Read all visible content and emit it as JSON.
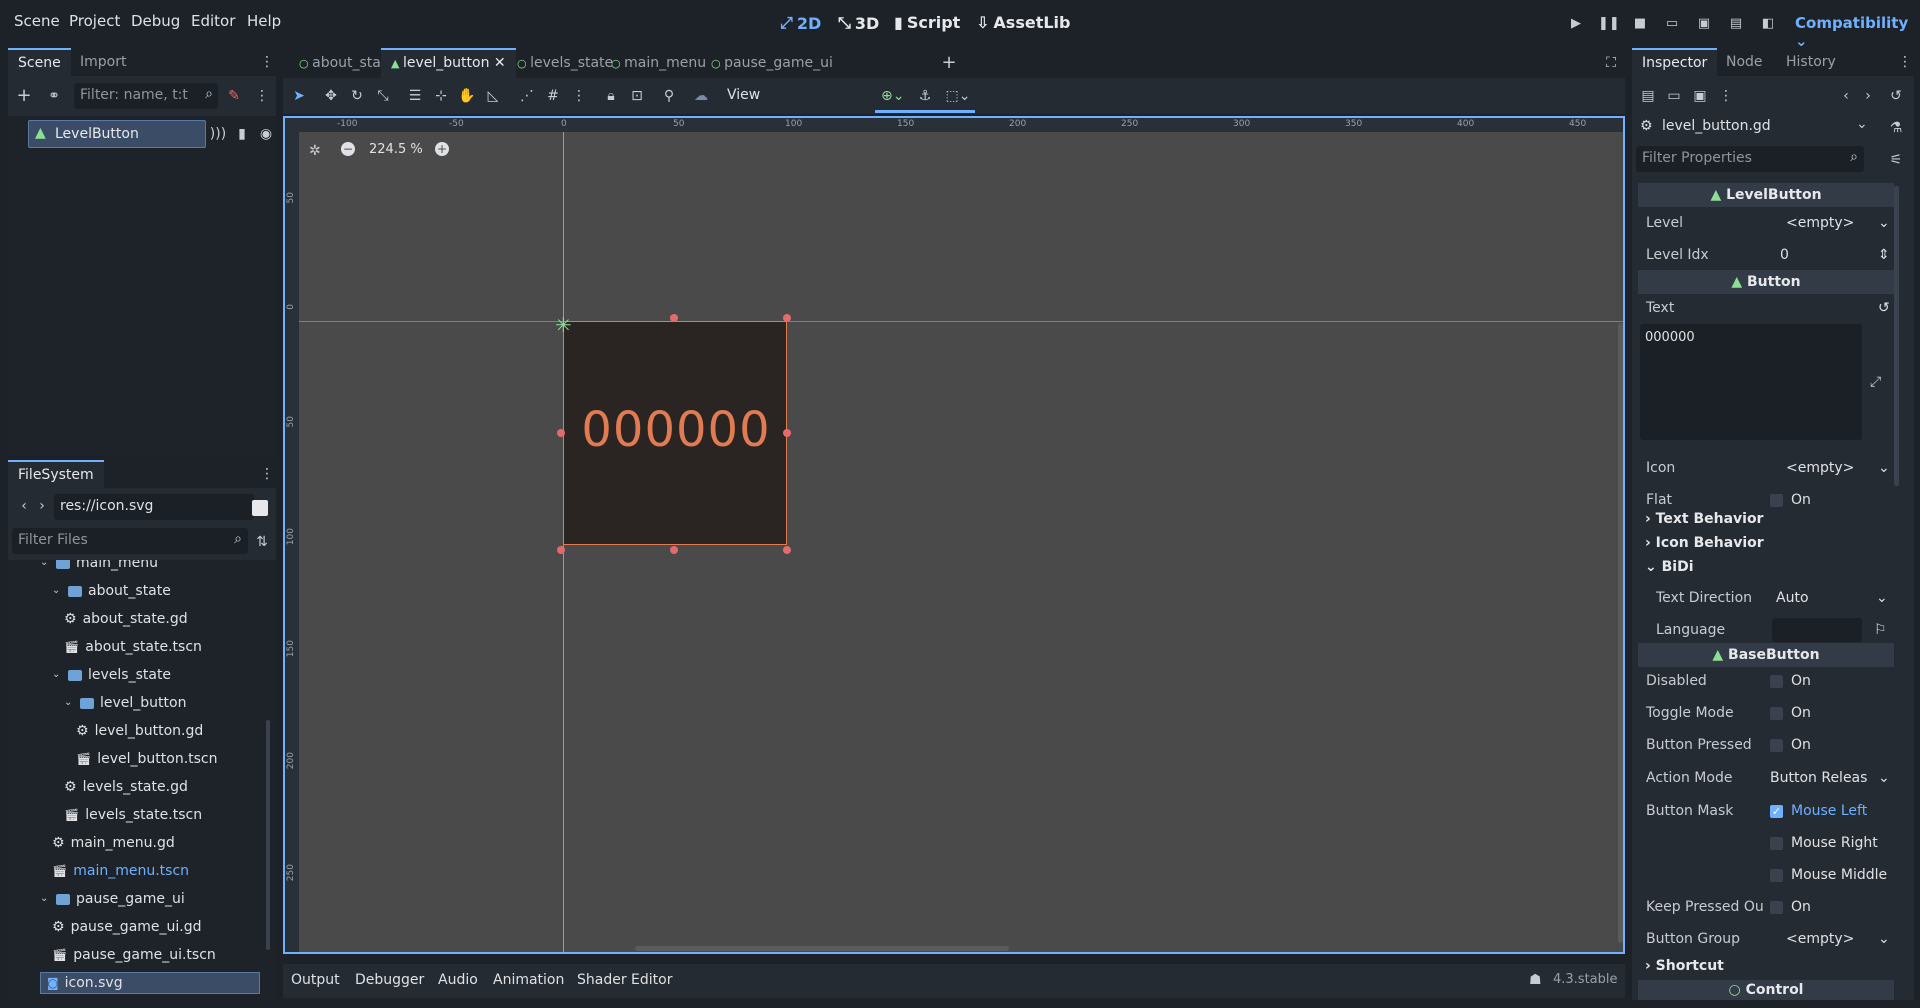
{
  "menu": [
    "Scene",
    "Project",
    "Debug",
    "Editor",
    "Help"
  ],
  "workspaces": [
    {
      "label": "2D",
      "icon": "2d-icon"
    },
    {
      "label": "3D",
      "icon": "3d-icon"
    },
    {
      "label": "Script",
      "icon": "script-icon"
    },
    {
      "label": "AssetLib",
      "icon": "assetlib-icon"
    }
  ],
  "renderer": "Compatibility",
  "scene_panel": {
    "tabs": [
      "Scene",
      "Import"
    ],
    "filter_placeholder": "Filter: name, t:t",
    "root_node": "LevelButton"
  },
  "filesystem": {
    "title": "FileSystem",
    "path": "res://icon.svg",
    "filter_placeholder": "Filter Files",
    "items": [
      {
        "label": "main_menu",
        "type": "folder",
        "indent": 1
      },
      {
        "label": "about_state",
        "type": "folder",
        "indent": 2
      },
      {
        "label": "about_state.gd",
        "type": "script",
        "indent": 3
      },
      {
        "label": "about_state.tscn",
        "type": "scene",
        "indent": 3
      },
      {
        "label": "levels_state",
        "type": "folder",
        "indent": 2
      },
      {
        "label": "level_button",
        "type": "folder",
        "indent": 3
      },
      {
        "label": "level_button.gd",
        "type": "script",
        "indent": 4
      },
      {
        "label": "level_button.tscn",
        "type": "scene",
        "indent": 4
      },
      {
        "label": "levels_state.gd",
        "type": "script",
        "indent": 3
      },
      {
        "label": "levels_state.tscn",
        "type": "scene",
        "indent": 3
      },
      {
        "label": "main_menu.gd",
        "type": "script",
        "indent": 2
      },
      {
        "label": "main_menu.tscn",
        "type": "scene",
        "indent": 2
      },
      {
        "label": "pause_game_ui",
        "type": "folder",
        "indent": 1
      },
      {
        "label": "pause_game_ui.gd",
        "type": "script",
        "indent": 2
      },
      {
        "label": "pause_game_ui.tscn",
        "type": "scene",
        "indent": 2
      },
      {
        "label": "icon.svg",
        "type": "image",
        "indent": 1
      }
    ]
  },
  "editor_tabs": [
    "about_state",
    "level_button",
    "levels_state",
    "main_menu",
    "pause_game_ui"
  ],
  "toolbar": {
    "view_label": "View"
  },
  "viewport": {
    "zoom": "224.5 %",
    "button_text": "000000",
    "ruler_top": [
      "-100",
      "-50",
      "0",
      "50",
      "100",
      "150",
      "200",
      "250",
      "300",
      "350",
      "400",
      "450"
    ],
    "ruler_left": [
      "50",
      "0",
      "50",
      "100",
      "150",
      "200",
      "250"
    ]
  },
  "bottom_tabs": [
    "Output",
    "Debugger",
    "Audio",
    "Animation",
    "Shader Editor"
  ],
  "version": "4.3.stable",
  "inspector": {
    "tabs": [
      "Inspector",
      "Node",
      "History"
    ],
    "script": "level_button.gd",
    "filter_placeholder": "Filter Properties",
    "sections": {
      "levelbutton": "LevelButton",
      "button": "Button",
      "basebutton": "BaseButton",
      "control": "Control"
    },
    "props": {
      "level": {
        "label": "Level",
        "value": "<empty>"
      },
      "level_idx": {
        "label": "Level Idx",
        "value": "0"
      },
      "text": {
        "label": "Text",
        "value": "000000"
      },
      "icon": {
        "label": "Icon",
        "value": "<empty>"
      },
      "flat": {
        "label": "Flat",
        "value": "On"
      },
      "text_behavior": "Text Behavior",
      "icon_behavior": "Icon Behavior",
      "bidi": "BiDi",
      "text_direction": {
        "label": "Text Direction",
        "value": "Auto"
      },
      "language": {
        "label": "Language",
        "value": ""
      },
      "disabled": {
        "label": "Disabled",
        "value": "On"
      },
      "toggle_mode": {
        "label": "Toggle Mode",
        "value": "On"
      },
      "button_pressed": {
        "label": "Button Pressed",
        "value": "On"
      },
      "action_mode": {
        "label": "Action Mode",
        "value": "Button Releas"
      },
      "button_mask": {
        "label": "Button Mask",
        "left": "Mouse Left",
        "right": "Mouse Right",
        "middle": "Mouse Middle"
      },
      "keep_pressed": {
        "label": "Keep Pressed Ou",
        "value": "On"
      },
      "button_group": {
        "label": "Button Group",
        "value": "<empty>"
      },
      "shortcut": "Shortcut"
    }
  },
  "colors": {
    "accent": "#6fb0ff",
    "node_green": "#8be095",
    "button_text": "#e07b52"
  }
}
